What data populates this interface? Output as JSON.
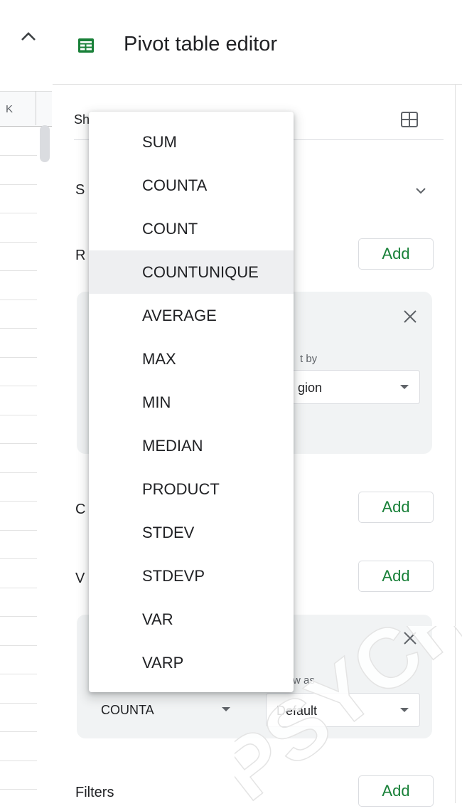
{
  "sheet": {
    "column_header": "K"
  },
  "panel": {
    "title": "Pivot table editor",
    "range_text": "Sh",
    "sections": {
      "suggested_initial": "S",
      "rows_initial": "R",
      "columns_initial": "C",
      "values_initial": "V",
      "filters": "Filters"
    },
    "add_label": "Add",
    "rows_card": {
      "sort_by_fragment": "t by",
      "sort_by_value_fragment": "gion"
    },
    "values_card": {
      "summarize_value": "COUNTA",
      "show_as_fragment": "w as",
      "show_as_value": "Default"
    }
  },
  "summarize_menu": {
    "items": [
      "SUM",
      "COUNTA",
      "COUNT",
      "COUNTUNIQUE",
      "AVERAGE",
      "MAX",
      "MIN",
      "MEDIAN",
      "PRODUCT",
      "STDEV",
      "STDEVP",
      "VAR",
      "VARP"
    ],
    "highlighted": "COUNTUNIQUE"
  },
  "colors": {
    "accent_green": "#188038",
    "menu_highlight": "#eeeff1",
    "card_bg": "#f1f3f4"
  },
  "watermark": {
    "text": "PSYCH"
  }
}
